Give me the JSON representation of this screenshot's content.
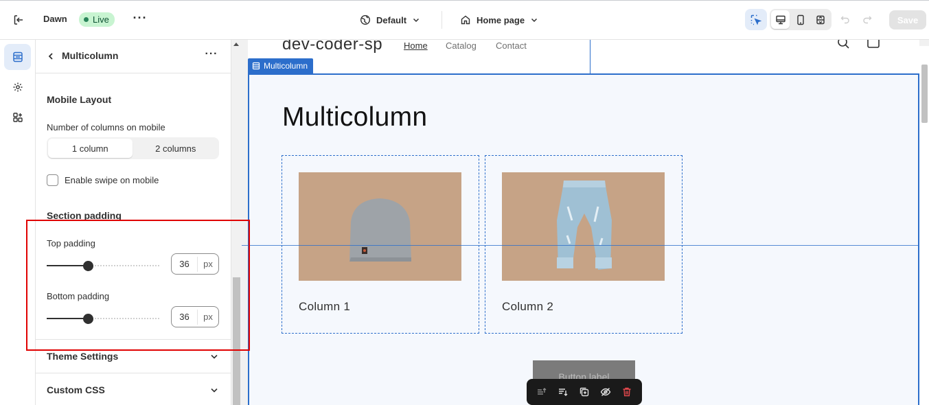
{
  "topbar": {
    "theme_name": "Dawn",
    "live_badge": "Live",
    "theme_select": "Default",
    "page_select": "Home page",
    "save_label": "Save",
    "accent": "#2c6ecb"
  },
  "rail": {
    "items": [
      {
        "icon": "sections-icon",
        "active": true
      },
      {
        "icon": "gear-icon",
        "active": false
      },
      {
        "icon": "apps-icon",
        "active": false
      }
    ]
  },
  "panel": {
    "title": "Multicolumn",
    "mobile_layout": {
      "heading": "Mobile Layout",
      "columns_label": "Number of columns on mobile",
      "options": [
        "1 column",
        "2 columns"
      ],
      "selected": "1 column",
      "swipe_label": "Enable swipe on mobile",
      "swipe_checked": false
    },
    "section_padding": {
      "heading": "Section padding",
      "top_label": "Top padding",
      "top_value": "36",
      "bottom_label": "Bottom padding",
      "bottom_value": "36",
      "unit": "px",
      "slider_fraction": 0.36
    },
    "accordions": [
      "Theme Settings",
      "Custom CSS"
    ]
  },
  "preview": {
    "store_name": "dev-coder-sp",
    "nav": [
      "Home",
      "Catalog",
      "Contact"
    ],
    "section_tag": "Multicolumn",
    "section_title": "Multicolumn",
    "columns": [
      {
        "caption": "Column 1",
        "image": "grey-beanie-photo"
      },
      {
        "caption": "Column 2",
        "image": "denim-jeans-photo"
      }
    ],
    "button_label": "Button label"
  }
}
